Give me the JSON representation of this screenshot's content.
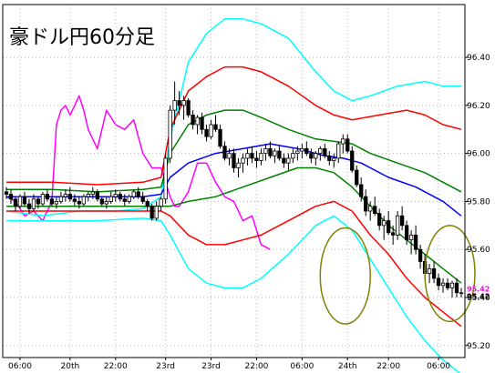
{
  "chart_data": {
    "type": "candlestick",
    "title": "豪ドル円60分足",
    "ylim": [
      95.15,
      96.62
    ],
    "yticks": [
      96.4,
      96.2,
      96.0,
      95.8,
      95.6,
      95.4,
      95.2
    ],
    "ytick_labels": [
      "96.40",
      "96.20",
      "96.00",
      "95.80",
      "95.60",
      "95.40",
      "95.20"
    ],
    "xtick_labels": [
      "06:00",
      "20th",
      "22:00",
      "23rd",
      "23rd",
      "22:00",
      "06:00",
      "24th",
      "22:00",
      "06:00"
    ],
    "xtick_index": [
      3,
      14,
      24,
      35,
      45,
      55,
      65,
      75,
      84,
      95
    ],
    "n_bars": 101,
    "grid": true,
    "last_value_labels": [
      {
        "text": "95.42",
        "color": "#000000"
      },
      {
        "text": "95.42",
        "color": "#ff00ff"
      }
    ],
    "candles": [
      [
        95.84,
        95.86,
        95.81,
        95.83
      ],
      [
        95.83,
        95.85,
        95.79,
        95.81
      ],
      [
        95.81,
        95.82,
        95.76,
        95.78
      ],
      [
        95.78,
        95.83,
        95.77,
        95.82
      ],
      [
        95.82,
        95.84,
        95.78,
        95.79
      ],
      [
        95.79,
        95.81,
        95.75,
        95.77
      ],
      [
        95.77,
        95.83,
        95.76,
        95.81
      ],
      [
        95.81,
        95.82,
        95.77,
        95.79
      ],
      [
        95.79,
        95.84,
        95.78,
        95.83
      ],
      [
        95.83,
        95.85,
        95.8,
        95.81
      ],
      [
        95.81,
        95.82,
        95.78,
        95.79
      ],
      [
        95.79,
        95.82,
        95.77,
        95.8
      ],
      [
        95.8,
        95.84,
        95.79,
        95.82
      ],
      [
        95.82,
        95.85,
        95.8,
        95.83
      ],
      [
        95.83,
        95.86,
        95.8,
        95.81
      ],
      [
        95.81,
        95.83,
        95.78,
        95.8
      ],
      [
        95.8,
        95.82,
        95.77,
        95.79
      ],
      [
        95.79,
        95.83,
        95.78,
        95.82
      ],
      [
        95.82,
        95.84,
        95.8,
        95.83
      ],
      [
        95.83,
        95.86,
        95.81,
        95.84
      ],
      [
        95.84,
        95.85,
        95.8,
        95.81
      ],
      [
        95.81,
        95.82,
        95.78,
        95.79
      ],
      [
        95.79,
        95.82,
        95.77,
        95.8
      ],
      [
        95.8,
        95.84,
        95.79,
        95.82
      ],
      [
        95.82,
        95.85,
        95.8,
        95.83
      ],
      [
        95.83,
        95.84,
        95.8,
        95.81
      ],
      [
        95.81,
        95.83,
        95.78,
        95.8
      ],
      [
        95.8,
        95.83,
        95.79,
        95.82
      ],
      [
        95.82,
        95.85,
        95.81,
        95.84
      ],
      [
        95.84,
        95.86,
        95.81,
        95.82
      ],
      [
        95.82,
        95.84,
        95.79,
        95.8
      ],
      [
        95.8,
        95.81,
        95.76,
        95.78
      ],
      [
        95.78,
        95.79,
        95.72,
        95.73
      ],
      [
        95.73,
        95.8,
        95.72,
        95.78
      ],
      [
        95.78,
        95.82,
        95.76,
        95.81
      ],
      [
        95.81,
        96.0,
        95.79,
        95.98
      ],
      [
        95.98,
        96.2,
        95.96,
        96.18
      ],
      [
        96.18,
        96.3,
        96.12,
        96.22
      ],
      [
        96.22,
        96.26,
        96.16,
        96.2
      ],
      [
        96.2,
        96.24,
        96.14,
        96.22
      ],
      [
        96.22,
        96.23,
        96.15,
        96.16
      ],
      [
        96.16,
        96.18,
        96.1,
        96.12
      ],
      [
        96.12,
        96.16,
        96.08,
        96.15
      ],
      [
        96.15,
        96.17,
        96.08,
        96.1
      ],
      [
        96.1,
        96.12,
        96.05,
        96.07
      ],
      [
        96.07,
        96.14,
        96.06,
        96.12
      ],
      [
        96.12,
        96.16,
        96.09,
        96.1
      ],
      [
        96.1,
        96.12,
        96.02,
        96.03
      ],
      [
        96.03,
        96.05,
        95.97,
        95.98
      ],
      [
        95.98,
        96.02,
        95.95,
        96.0
      ],
      [
        96.0,
        96.02,
        95.92,
        95.94
      ],
      [
        95.94,
        95.98,
        95.9,
        95.96
      ],
      [
        95.96,
        96.0,
        95.92,
        95.98
      ],
      [
        95.98,
        96.02,
        95.95,
        96.0
      ],
      [
        96.0,
        96.03,
        95.96,
        95.98
      ],
      [
        95.98,
        96.01,
        95.94,
        95.97
      ],
      [
        95.97,
        96.02,
        95.95,
        96.0
      ],
      [
        96.0,
        96.04,
        95.97,
        96.02
      ],
      [
        96.02,
        96.05,
        95.98,
        95.99
      ],
      [
        95.99,
        96.02,
        95.96,
        96.01
      ],
      [
        96.01,
        96.03,
        95.97,
        95.98
      ],
      [
        95.98,
        96.0,
        95.94,
        95.96
      ],
      [
        95.96,
        96.0,
        95.93,
        95.98
      ],
      [
        95.98,
        96.02,
        95.96,
        96.0
      ],
      [
        96.0,
        96.03,
        95.97,
        96.01
      ],
      [
        96.01,
        96.04,
        95.98,
        96.02
      ],
      [
        96.02,
        96.05,
        95.99,
        96.0
      ],
      [
        96.0,
        96.02,
        95.96,
        95.98
      ],
      [
        95.98,
        96.01,
        95.95,
        96.0
      ],
      [
        96.0,
        96.03,
        95.97,
        96.02
      ],
      [
        96.02,
        96.04,
        95.98,
        95.99
      ],
      [
        95.99,
        96.01,
        95.95,
        95.97
      ],
      [
        95.97,
        96.0,
        95.94,
        95.98
      ],
      [
        95.98,
        96.05,
        95.96,
        96.04
      ],
      [
        96.04,
        96.08,
        96.0,
        96.06
      ],
      [
        96.06,
        96.08,
        96.0,
        96.01
      ],
      [
        96.01,
        96.03,
        95.92,
        95.93
      ],
      [
        95.93,
        95.95,
        95.86,
        95.87
      ],
      [
        95.87,
        95.9,
        95.8,
        95.82
      ],
      [
        95.82,
        95.85,
        95.74,
        95.76
      ],
      [
        95.76,
        95.8,
        95.72,
        95.78
      ],
      [
        95.78,
        95.82,
        95.74,
        95.75
      ],
      [
        95.75,
        95.77,
        95.68,
        95.7
      ],
      [
        95.7,
        95.74,
        95.64,
        95.72
      ],
      [
        95.72,
        95.76,
        95.66,
        95.67
      ],
      [
        95.67,
        95.7,
        95.62,
        95.66
      ],
      [
        95.66,
        95.76,
        95.64,
        95.74
      ],
      [
        95.74,
        95.78,
        95.68,
        95.7
      ],
      [
        95.7,
        95.72,
        95.62,
        95.64
      ],
      [
        95.64,
        95.68,
        95.58,
        95.66
      ],
      [
        95.66,
        95.7,
        95.58,
        95.6
      ],
      [
        95.6,
        95.62,
        95.52,
        95.55
      ],
      [
        95.55,
        95.58,
        95.48,
        95.5
      ],
      [
        95.5,
        95.54,
        95.46,
        95.52
      ],
      [
        95.52,
        95.55,
        95.46,
        95.48
      ],
      [
        95.48,
        95.5,
        95.43,
        95.45
      ],
      [
        95.45,
        95.48,
        95.42,
        95.46
      ],
      [
        95.46,
        95.48,
        95.43,
        95.44
      ],
      [
        95.44,
        95.47,
        95.4,
        95.46
      ],
      [
        95.46,
        95.48,
        95.4,
        95.42
      ],
      [
        95.42,
        95.44,
        95.4,
        95.42
      ]
    ],
    "series": [
      {
        "color": "#ff00ff",
        "points": [
          [
            0,
            95.82
          ],
          [
            2,
            95.8
          ],
          [
            4,
            95.74
          ],
          [
            6,
            95.76
          ],
          [
            8,
            95.72
          ],
          [
            10,
            95.8
          ],
          [
            11,
            96.12
          ],
          [
            12,
            96.18
          ],
          [
            13,
            96.2
          ],
          [
            14,
            96.16
          ],
          [
            15,
            96.2
          ],
          [
            16,
            96.24
          ],
          [
            17,
            96.18
          ],
          [
            18,
            96.1
          ],
          [
            20,
            96.02
          ],
          [
            22,
            96.18
          ],
          [
            24,
            96.12
          ],
          [
            26,
            96.1
          ],
          [
            28,
            96.14
          ],
          [
            30,
            96.0
          ],
          [
            32,
            95.94
          ],
          [
            34,
            95.94
          ],
          [
            35,
            95.88
          ],
          [
            36,
            95.82
          ],
          [
            37,
            95.78
          ],
          [
            38,
            95.78
          ],
          [
            40,
            95.84
          ],
          [
            42,
            95.96
          ],
          [
            44,
            95.96
          ],
          [
            46,
            95.88
          ],
          [
            48,
            95.82
          ],
          [
            50,
            95.8
          ],
          [
            52,
            95.72
          ],
          [
            54,
            95.74
          ],
          [
            56,
            95.62
          ],
          [
            58,
            95.6
          ]
        ]
      },
      {
        "color": "#00ffff",
        "points": [
          [
            0,
            95.76
          ],
          [
            8,
            95.74
          ],
          [
            16,
            95.76
          ],
          [
            24,
            95.76
          ],
          [
            30,
            95.77
          ],
          [
            34,
            95.82
          ],
          [
            36,
            96.06
          ],
          [
            40,
            96.38
          ],
          [
            44,
            96.5
          ],
          [
            48,
            96.56
          ],
          [
            52,
            96.56
          ],
          [
            56,
            96.54
          ],
          [
            62,
            96.48
          ],
          [
            68,
            96.34
          ],
          [
            72,
            96.26
          ],
          [
            76,
            96.22
          ],
          [
            80,
            96.24
          ],
          [
            86,
            96.28
          ],
          [
            92,
            96.3
          ],
          [
            96,
            96.28
          ],
          [
            98,
            96.28
          ],
          [
            100,
            96.28
          ]
        ]
      },
      {
        "color": "#ff0000",
        "points": [
          [
            0,
            95.88
          ],
          [
            10,
            95.88
          ],
          [
            20,
            95.87
          ],
          [
            30,
            95.88
          ],
          [
            34,
            95.9
          ],
          [
            36,
            96.1
          ],
          [
            40,
            96.26
          ],
          [
            44,
            96.32
          ],
          [
            48,
            96.36
          ],
          [
            52,
            96.36
          ],
          [
            56,
            96.34
          ],
          [
            62,
            96.28
          ],
          [
            68,
            96.2
          ],
          [
            72,
            96.16
          ],
          [
            76,
            96.14
          ],
          [
            82,
            96.16
          ],
          [
            88,
            96.18
          ],
          [
            92,
            96.16
          ],
          [
            96,
            96.12
          ],
          [
            100,
            96.1
          ]
        ]
      },
      {
        "color": "#008000",
        "points": [
          [
            0,
            95.85
          ],
          [
            10,
            95.85
          ],
          [
            20,
            95.84
          ],
          [
            30,
            95.85
          ],
          [
            34,
            95.86
          ],
          [
            36,
            96.0
          ],
          [
            40,
            96.12
          ],
          [
            44,
            96.16
          ],
          [
            48,
            96.18
          ],
          [
            52,
            96.18
          ],
          [
            56,
            96.15
          ],
          [
            62,
            96.1
          ],
          [
            68,
            96.06
          ],
          [
            72,
            96.05
          ],
          [
            76,
            96.04
          ],
          [
            80,
            96.0
          ],
          [
            86,
            95.96
          ],
          [
            92,
            95.92
          ],
          [
            96,
            95.88
          ],
          [
            100,
            95.84
          ]
        ]
      },
      {
        "color": "#0000ff",
        "points": [
          [
            0,
            95.82
          ],
          [
            10,
            95.82
          ],
          [
            20,
            95.82
          ],
          [
            30,
            95.82
          ],
          [
            34,
            95.83
          ],
          [
            36,
            95.9
          ],
          [
            40,
            95.96
          ],
          [
            46,
            96.0
          ],
          [
            52,
            96.02
          ],
          [
            58,
            96.04
          ],
          [
            64,
            96.02
          ],
          [
            70,
            95.99
          ],
          [
            74,
            95.98
          ],
          [
            78,
            95.96
          ],
          [
            84,
            95.9
          ],
          [
            90,
            95.86
          ],
          [
            96,
            95.8
          ],
          [
            100,
            95.74
          ]
        ]
      },
      {
        "color": "#008000",
        "points": [
          [
            0,
            95.78
          ],
          [
            10,
            95.78
          ],
          [
            20,
            95.78
          ],
          [
            30,
            95.78
          ],
          [
            34,
            95.78
          ],
          [
            36,
            95.78
          ],
          [
            40,
            95.8
          ],
          [
            46,
            95.82
          ],
          [
            52,
            95.86
          ],
          [
            58,
            95.9
          ],
          [
            64,
            95.94
          ],
          [
            68,
            95.94
          ],
          [
            72,
            95.92
          ],
          [
            76,
            95.86
          ],
          [
            80,
            95.78
          ],
          [
            84,
            95.7
          ],
          [
            88,
            95.64
          ],
          [
            92,
            95.58
          ],
          [
            96,
            95.52
          ],
          [
            100,
            95.46
          ]
        ]
      },
      {
        "color": "#ff0000",
        "points": [
          [
            0,
            95.76
          ],
          [
            10,
            95.76
          ],
          [
            20,
            95.76
          ],
          [
            30,
            95.76
          ],
          [
            34,
            95.76
          ],
          [
            36,
            95.74
          ],
          [
            40,
            95.66
          ],
          [
            44,
            95.62
          ],
          [
            48,
            95.62
          ],
          [
            52,
            95.64
          ],
          [
            56,
            95.66
          ],
          [
            62,
            95.72
          ],
          [
            68,
            95.78
          ],
          [
            72,
            95.8
          ],
          [
            76,
            95.76
          ],
          [
            80,
            95.66
          ],
          [
            84,
            95.58
          ],
          [
            88,
            95.48
          ],
          [
            92,
            95.4
          ],
          [
            96,
            95.34
          ],
          [
            100,
            95.28
          ]
        ]
      },
      {
        "color": "#00ffff",
        "points": [
          [
            0,
            95.72
          ],
          [
            10,
            95.72
          ],
          [
            20,
            95.72
          ],
          [
            30,
            95.73
          ],
          [
            34,
            95.72
          ],
          [
            36,
            95.66
          ],
          [
            40,
            95.52
          ],
          [
            44,
            95.46
          ],
          [
            48,
            95.44
          ],
          [
            52,
            95.44
          ],
          [
            56,
            95.48
          ],
          [
            62,
            95.58
          ],
          [
            68,
            95.7
          ],
          [
            72,
            95.74
          ],
          [
            76,
            95.68
          ],
          [
            80,
            95.56
          ],
          [
            84,
            95.44
          ],
          [
            88,
            95.32
          ],
          [
            92,
            95.22
          ],
          [
            96,
            95.14
          ],
          [
            100,
            95.08
          ]
        ]
      }
    ],
    "annotations": [
      {
        "type": "ellipse",
        "color": "#808000",
        "cx": 74.5,
        "cy": 95.49,
        "rx": 5.5,
        "ry": 0.2
      },
      {
        "type": "ellipse",
        "color": "#808000",
        "cx": 97.5,
        "cy": 95.5,
        "rx": 5.5,
        "ry": 0.2
      }
    ]
  }
}
